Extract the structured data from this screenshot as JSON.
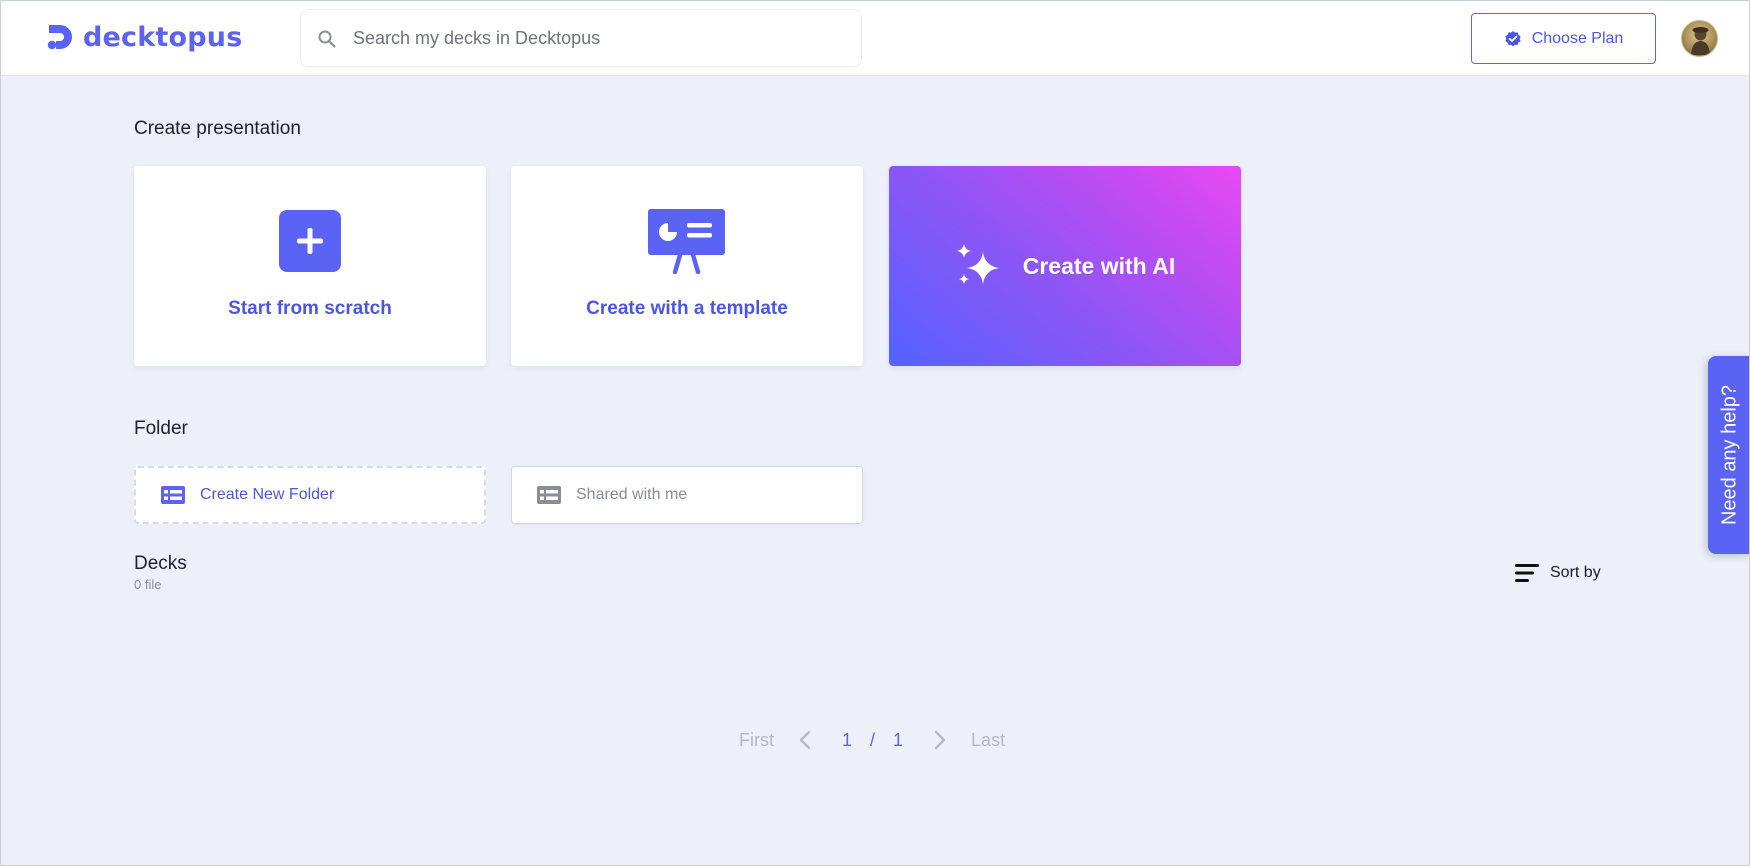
{
  "brand": {
    "name": "decktopus",
    "color": "#5b63f5"
  },
  "search": {
    "placeholder": "Search my decks in Decktopus",
    "value": "",
    "icon": "search-icon"
  },
  "header": {
    "choose_plan_label": "Choose Plan",
    "choose_plan_icon": "verified-badge-icon",
    "avatar_icon": "user-avatar"
  },
  "create_section": {
    "title": "Create presentation",
    "cards": [
      {
        "label": "Start from scratch",
        "icon": "plus-icon"
      },
      {
        "label": "Create with a template",
        "icon": "presentation-board-icon"
      },
      {
        "label": "Create with AI",
        "icon": "sparkles-icon",
        "gradient": [
          "#5462ff",
          "#e949f3"
        ]
      }
    ]
  },
  "folder_section": {
    "title": "Folder",
    "create_label": "Create New Folder",
    "shared_label": "Shared with me",
    "icon": "folder-list-icon"
  },
  "decks_section": {
    "title": "Decks",
    "count_label": "0 file",
    "sort_label": "Sort by",
    "sort_icon": "sort-lines-icon"
  },
  "pagination": {
    "first_label": "First",
    "last_label": "Last",
    "current_page": "1",
    "separator": "/",
    "total_pages": "1"
  },
  "help": {
    "label": "Need any help?"
  },
  "colors": {
    "accent": "#5b63f5",
    "background": "#edf0f8",
    "muted_text": "#b7bac3"
  }
}
